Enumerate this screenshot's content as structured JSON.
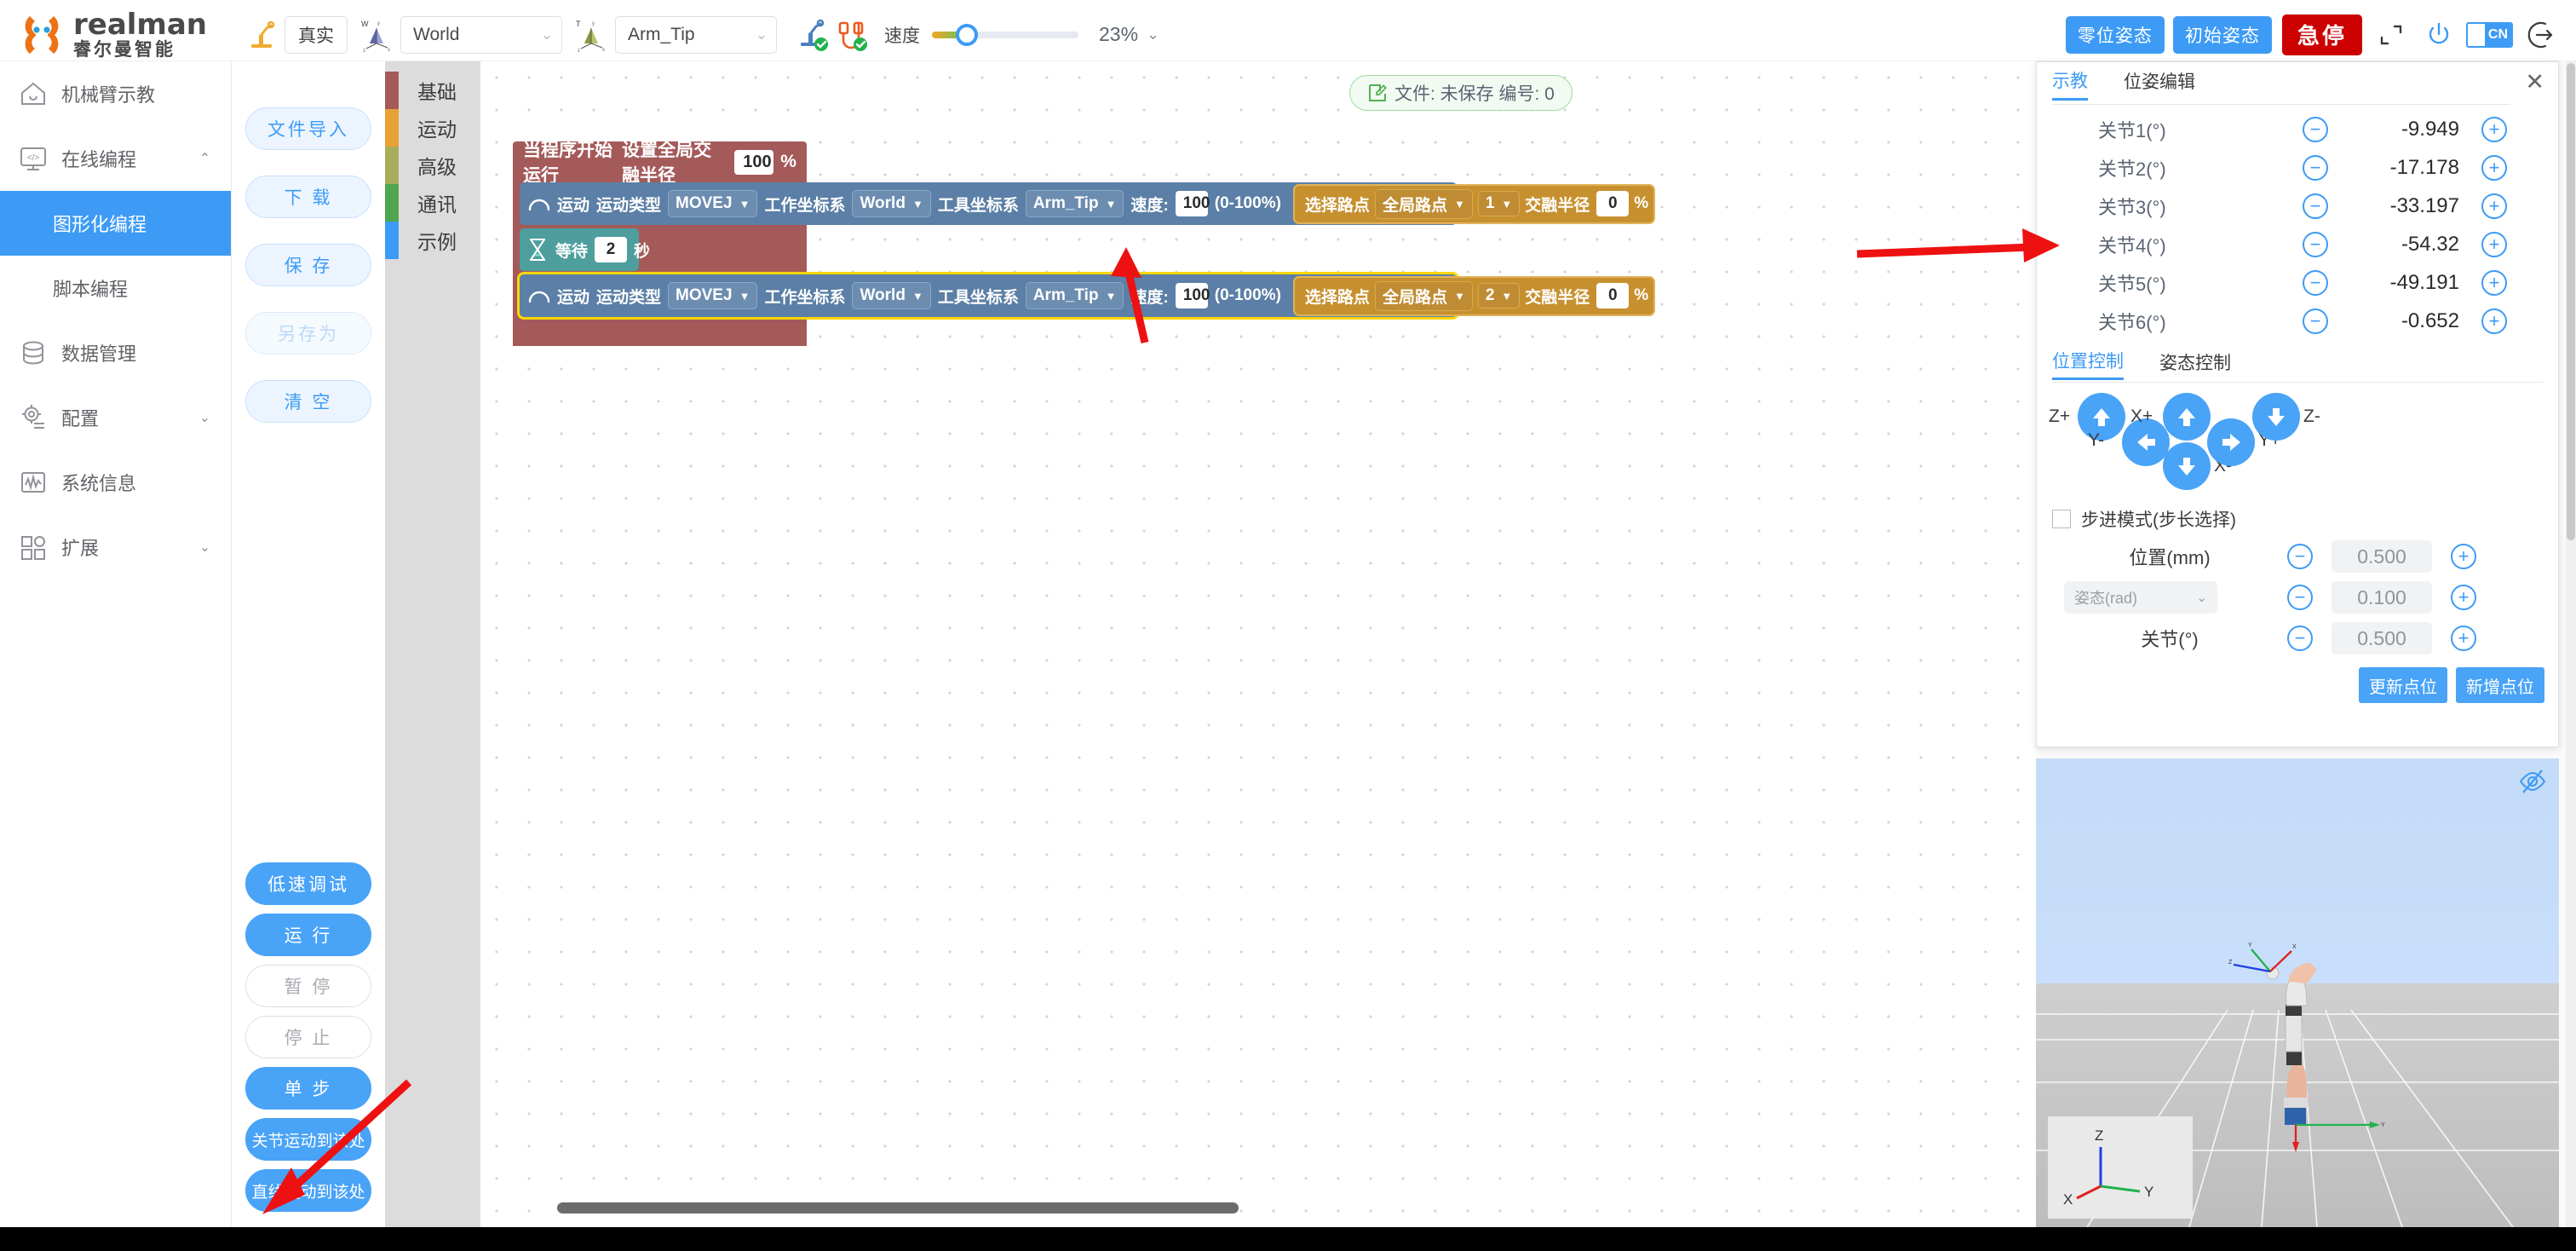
{
  "brand": {
    "name_en": "realman",
    "name_cn": "睿尔曼智能"
  },
  "topbar": {
    "mode_button": "真实",
    "work_frame": {
      "icon_label": "W",
      "value": "World"
    },
    "tool_frame": {
      "icon_label": "T",
      "value": "Arm_Tip"
    },
    "speed_label": "速度",
    "speed_value": "23%",
    "zero_pose_button": "零位姿态",
    "init_pose_button": "初始姿态",
    "estop_button": "急停",
    "lang_code": "CN"
  },
  "sidebar": {
    "items": [
      {
        "label": "机械臂示教",
        "icon": "home-icon",
        "expandable": false
      },
      {
        "label": "在线编程",
        "icon": "code-monitor-icon",
        "expandable": true,
        "chevron": "⌃"
      },
      {
        "label": "数据管理",
        "icon": "database-icon",
        "expandable": false
      },
      {
        "label": "配置",
        "icon": "gear-icon",
        "expandable": true,
        "chevron": "⌄"
      },
      {
        "label": "系统信息",
        "icon": "waveform-icon",
        "expandable": false
      },
      {
        "label": "扩展",
        "icon": "modules-icon",
        "expandable": true,
        "chevron": "⌄"
      }
    ],
    "sub_items": [
      {
        "label": "图形化编程",
        "active": true
      },
      {
        "label": "脚本编程",
        "active": false
      }
    ]
  },
  "file_buttons": [
    {
      "label": "文件导入",
      "state": "soft"
    },
    {
      "label": "下 载",
      "state": "soft"
    },
    {
      "label": "保 存",
      "state": "soft"
    },
    {
      "label": "另存为",
      "state": "disabled"
    },
    {
      "label": "清 空",
      "state": "soft"
    }
  ],
  "run_buttons": [
    {
      "label": "低速调试",
      "state": "solid"
    },
    {
      "label": "运 行",
      "state": "solid"
    },
    {
      "label": "暂 停",
      "state": "ghost"
    },
    {
      "label": "停 止",
      "state": "ghost"
    },
    {
      "label": "单 步",
      "state": "solid"
    },
    {
      "label": "关节运动到该处",
      "state": "solid-sm"
    },
    {
      "label": "直线运动到该处",
      "state": "solid-sm"
    }
  ],
  "palette": [
    {
      "label": "基础",
      "color": "#a55a5a"
    },
    {
      "label": "运动",
      "color": "#e8a133"
    },
    {
      "label": "高级",
      "color": "#a8ad5c"
    },
    {
      "label": "通讯",
      "color": "#4fa64f"
    },
    {
      "label": "示例",
      "color": "#3d9bf5"
    }
  ],
  "workspace": {
    "file_chip": "文件: 未保存  编号: 0",
    "hat_block": {
      "text_a": "当程序开始运行",
      "text_b": "设置全局交融半径",
      "radius": "100",
      "percent": "%"
    },
    "blocks": [
      {
        "kind": "move",
        "word": "运动",
        "type_label": "运动类型",
        "type_value": "MOVEJ",
        "work_label": "工作坐标系",
        "work_value": "World",
        "tool_label": "工具坐标系",
        "tool_value": "Arm_Tip",
        "speed_label": "速度:",
        "speed_value": "100",
        "speed_range": "(0-100%)",
        "wp_label": "选择路点",
        "wp_source": "全局路点",
        "wp_index": "1",
        "blend_label": "交融半径",
        "blend_value": "0",
        "blend_unit": "%",
        "selected": false
      },
      {
        "kind": "wait",
        "word": "等待",
        "value": "2",
        "unit": "秒"
      },
      {
        "kind": "move",
        "word": "运动",
        "type_label": "运动类型",
        "type_value": "MOVEJ",
        "work_label": "工作坐标系",
        "work_value": "World",
        "tool_label": "工具坐标系",
        "tool_value": "Arm_Tip",
        "speed_label": "速度:",
        "speed_value": "100",
        "speed_range": "(0-100%)",
        "wp_label": "选择路点",
        "wp_source": "全局路点",
        "wp_index": "2",
        "blend_label": "交融半径",
        "blend_value": "0",
        "blend_unit": "%",
        "selected": true
      }
    ]
  },
  "teach_panel": {
    "tabs": [
      {
        "label": "示教",
        "active": true
      },
      {
        "label": "位姿编辑",
        "active": false
      }
    ],
    "close": "✕",
    "joints": [
      {
        "label": "关节1(°)",
        "value": "-9.949"
      },
      {
        "label": "关节2(°)",
        "value": "-17.178"
      },
      {
        "label": "关节3(°)",
        "value": "-33.197"
      },
      {
        "label": "关节4(°)",
        "value": "-54.32"
      },
      {
        "label": "关节5(°)",
        "value": "-49.191"
      },
      {
        "label": "关节6(°)",
        "value": "-0.652"
      }
    ],
    "minus": "−",
    "plus": "+",
    "sub_tabs": [
      {
        "label": "位置控制",
        "active": true
      },
      {
        "label": "姿态控制",
        "active": false
      }
    ],
    "jog_labels": {
      "z_plus": "Z+",
      "z_minus": "Z-",
      "x_plus": "X+",
      "x_minus": "X-",
      "y_plus": "Y+",
      "y_minus": "Y-"
    },
    "step_mode_label": "步进模式(步长选择)",
    "steps": [
      {
        "label": "位置(mm)",
        "value": "0.500",
        "is_select": false
      },
      {
        "label": "姿态(rad)",
        "value": "0.100",
        "is_select": true
      },
      {
        "label": "关节(°)",
        "value": "0.500",
        "is_select": false
      }
    ],
    "update_point_button": "更新点位",
    "add_point_button": "新增点位"
  },
  "viewport": {
    "axis_labels": {
      "z": "Z",
      "x": "X",
      "y": "Y"
    },
    "eye_icon": "eye-off-icon"
  },
  "colors": {
    "accent": "#3d9bf5",
    "danger": "#cc0000",
    "basic_block": "#a55a5a",
    "move_block": "#5b7fa6",
    "wait_block": "#4e9e9e",
    "waypoint_group": "#c7902f",
    "selection": "#ffd600",
    "annotation_arrow": "#ee1111"
  }
}
